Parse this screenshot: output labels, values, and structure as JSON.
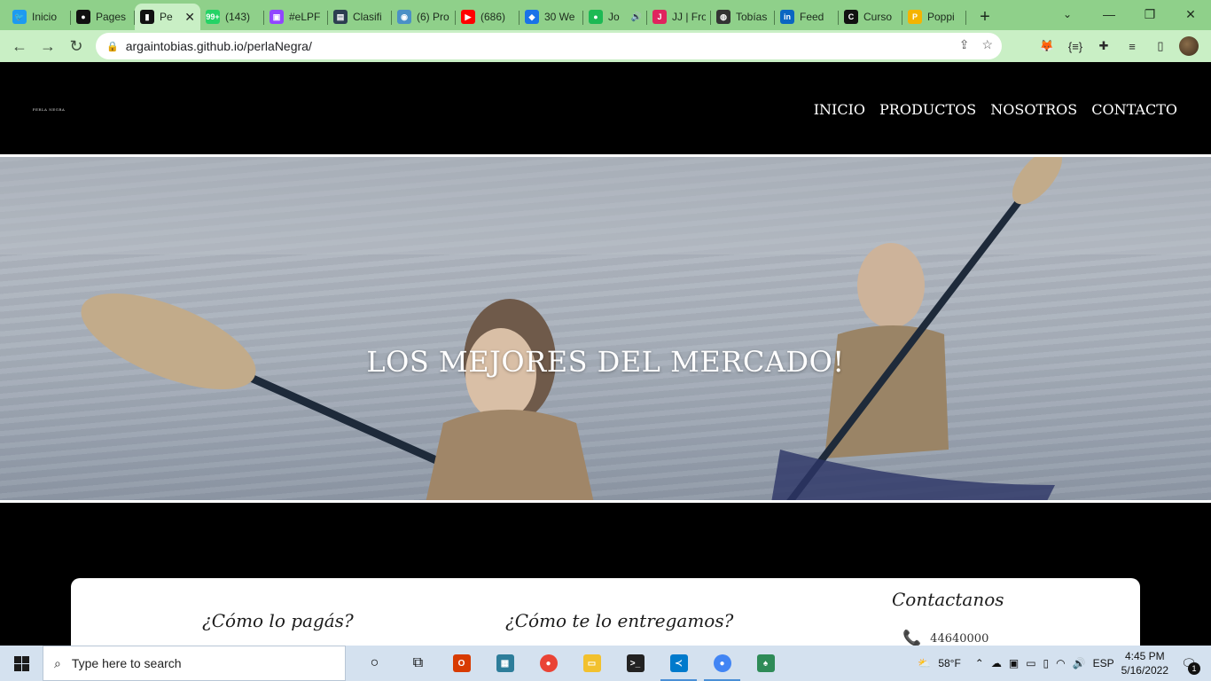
{
  "browser": {
    "tabs": [
      {
        "title": "Inicio",
        "icon": "twitter-icon",
        "color": "#1d9bf0",
        "glyph": "🐦"
      },
      {
        "title": "Pages",
        "icon": "github-icon",
        "color": "#111111",
        "glyph": "●"
      },
      {
        "title": "Pe",
        "icon": "page-icon",
        "color": "#111111",
        "glyph": "▮",
        "active": true
      },
      {
        "title": "(143)",
        "icon": "whatsapp-icon",
        "color": "#25d366",
        "glyph": "99+"
      },
      {
        "title": "#eLPF",
        "icon": "twitch-icon",
        "color": "#9146ff",
        "glyph": "▣"
      },
      {
        "title": "Clasifi",
        "icon": "clasificados-icon",
        "color": "#2c3e50",
        "glyph": "▤"
      },
      {
        "title": "(6) Pro",
        "icon": "platzi-icon",
        "color": "#4a90c6",
        "glyph": "◉"
      },
      {
        "title": "(686)",
        "icon": "youtube-icon",
        "color": "#ff0000",
        "glyph": "▶"
      },
      {
        "title": "30 We",
        "icon": "extension-icon",
        "color": "#1a73e8",
        "glyph": "◆"
      },
      {
        "title": "Jo",
        "icon": "spotify-icon",
        "color": "#1db954",
        "glyph": "●",
        "audio": true
      },
      {
        "title": "JJ | Fro",
        "icon": "jj-icon",
        "color": "#e0245e",
        "glyph": "J"
      },
      {
        "title": "Tobías",
        "icon": "globe-icon",
        "color": "#333333",
        "glyph": "◍"
      },
      {
        "title": "Feed",
        "icon": "linkedin-icon",
        "color": "#0a66c2",
        "glyph": "in"
      },
      {
        "title": "Curso",
        "icon": "coder-icon",
        "color": "#111111",
        "glyph": "C"
      },
      {
        "title": "Poppi",
        "icon": "poppins-icon",
        "color": "#f4b400",
        "glyph": "P"
      }
    ],
    "url": "argaintobias.github.io/perlaNegra/"
  },
  "site": {
    "logo_text": "PERLA NEGRA",
    "nav": [
      "INICIO",
      "PRODUCTOS",
      "NOSOTROS",
      "CONTACTO"
    ],
    "hero_title": "LOS MEJORES DEL MERCADO!",
    "footer": {
      "pay_title": "¿Cómo lo pagás?",
      "delivery_title": "¿Cómo te lo entregamos?",
      "contact_title": "Contactanos",
      "phone": "44640000"
    }
  },
  "taskbar": {
    "search_placeholder": "Type here to search",
    "weather": "58°F",
    "language": "ESP",
    "time": "4:45 PM",
    "date": "5/16/2022",
    "notifications": "1"
  }
}
